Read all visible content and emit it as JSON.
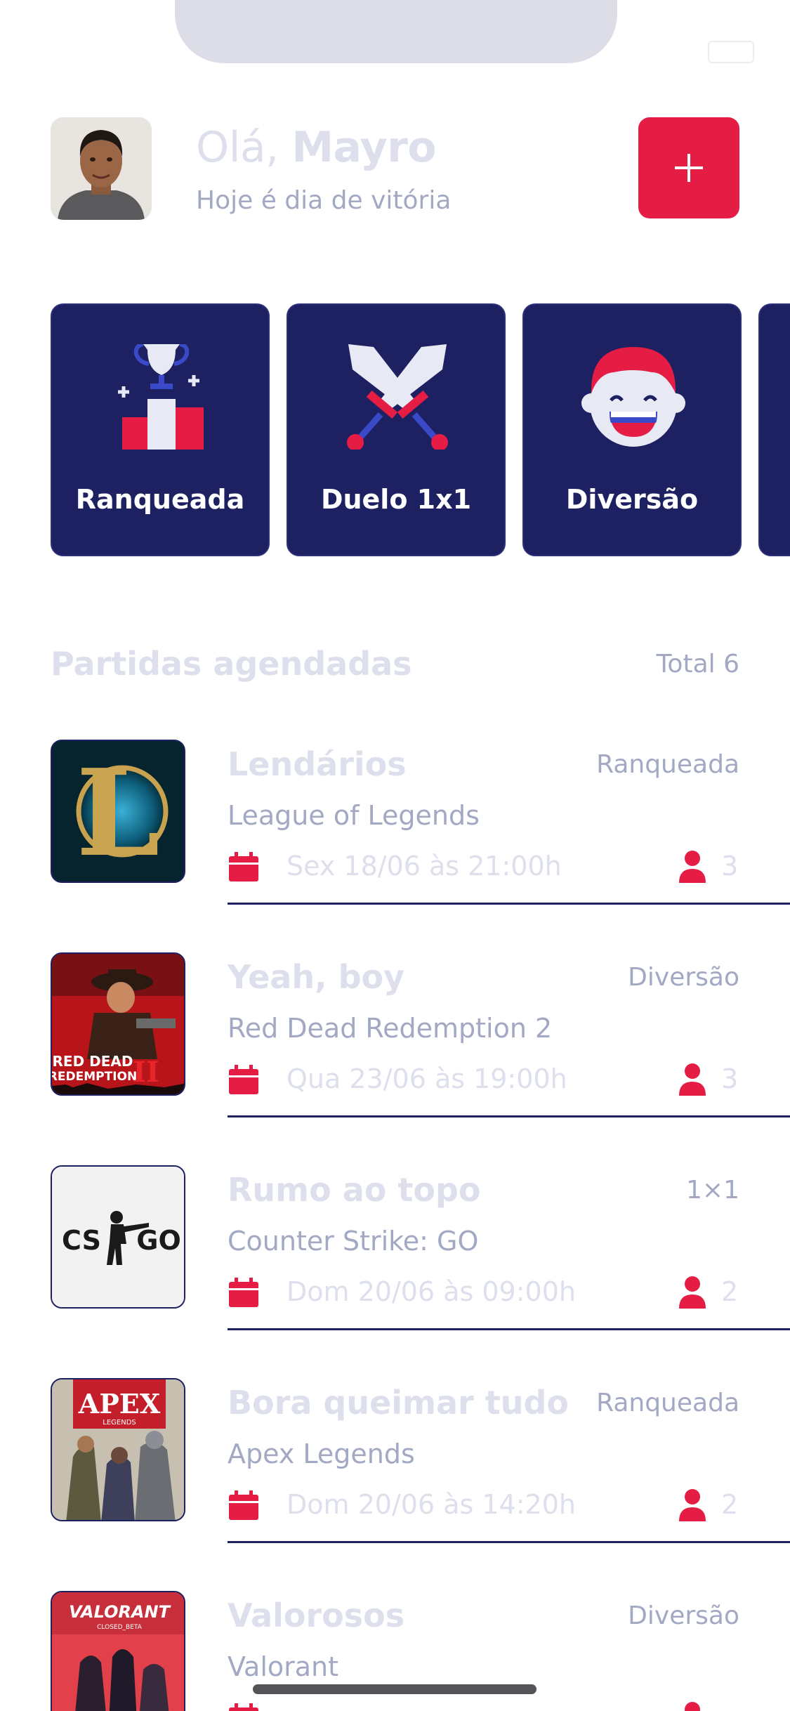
{
  "header": {
    "greeting_prefix": "Olá, ",
    "user_name": "Mayro",
    "subtitle": "Hoje é dia de vitória",
    "add_icon": "plus-icon"
  },
  "categories": [
    {
      "label": "Ranqueada",
      "icon": "podium-trophy-icon"
    },
    {
      "label": "Duelo 1x1",
      "icon": "crossed-swords-icon"
    },
    {
      "label": "Diversão",
      "icon": "laughing-face-icon"
    }
  ],
  "section": {
    "title": "Partidas agendadas",
    "total": "Total 6"
  },
  "matches": [
    {
      "title": "Lendários",
      "category": "Ranqueada",
      "game": "League of Legends",
      "date": "Sex 18/06 às 21:00h",
      "players": "3"
    },
    {
      "title": "Yeah, boy",
      "category": "Diversão",
      "game": "Red Dead Redemption 2",
      "date": "Qua 23/06 às 19:00h",
      "players": "3"
    },
    {
      "title": "Rumo ao topo",
      "category": "1×1",
      "game": "Counter Strike: GO",
      "date": "Dom 20/06 às 09:00h",
      "players": "2"
    },
    {
      "title": "Bora queimar tudo",
      "category": "Ranqueada",
      "game": "Apex Legends",
      "date": "Dom 20/06 às 14:20h",
      "players": "2"
    },
    {
      "title": "Valorosos",
      "category": "Diversão",
      "game": "Valorant",
      "date": "",
      "players": ""
    }
  ],
  "logos": {
    "lol": "L",
    "rdr_top": "RED DEAD",
    "rdr_bottom": "REDEMPTION",
    "rdr_numeral": "II",
    "csgo_left": "CS",
    "csgo_right": "GO",
    "apex": "APEX",
    "apex_sub": "LEGENDS",
    "valorant": "VALORANT",
    "valorant_sub": "CLOSED_BETA"
  },
  "colors": {
    "accent": "#E51C44",
    "card": "#1D2161",
    "muted_text": "#A3A8C3",
    "faint_text": "#DDE0EC"
  }
}
